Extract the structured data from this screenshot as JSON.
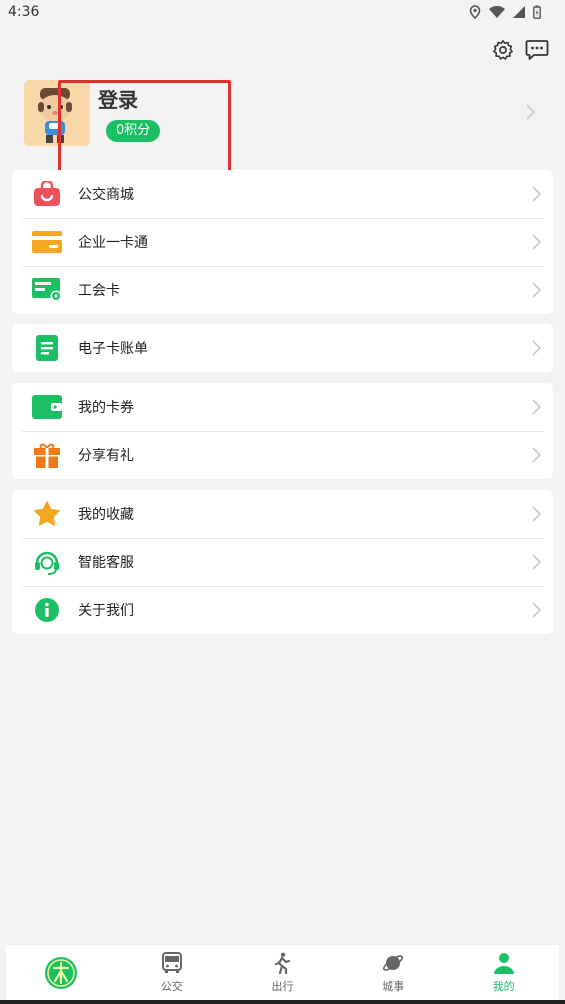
{
  "status_bar": {
    "time": "4:36",
    "icons": [
      "location-icon",
      "wifi-icon",
      "signal-icon",
      "battery-icon"
    ]
  },
  "header": {
    "actions": [
      "settings-icon",
      "message-icon"
    ]
  },
  "profile": {
    "name": "登录",
    "points": "0积分"
  },
  "menu_groups": [
    {
      "items": [
        {
          "label": "公交商城",
          "icon": "shopping-bag-icon",
          "color": "#f0505a"
        },
        {
          "label": "企业一卡通",
          "icon": "card-icon",
          "color": "#f5a623"
        },
        {
          "label": "工会卡",
          "icon": "union-card-icon",
          "color": "#1cbf63"
        }
      ]
    },
    {
      "items": [
        {
          "label": "电子卡账单",
          "icon": "bill-icon",
          "color": "#1cbf63"
        }
      ]
    },
    {
      "items": [
        {
          "label": "我的卡券",
          "icon": "wallet-icon",
          "color": "#1cbf63"
        },
        {
          "label": "分享有礼",
          "icon": "gift-icon",
          "color": "#f07a1a"
        }
      ]
    },
    {
      "items": [
        {
          "label": "我的收藏",
          "icon": "star-icon",
          "color": "#f5a623"
        },
        {
          "label": "智能客服",
          "icon": "headset-icon",
          "color": "#1cbf63"
        },
        {
          "label": "关于我们",
          "icon": "info-icon",
          "color": "#1cbf63"
        }
      ]
    }
  ],
  "tabs": [
    {
      "label": "",
      "icon": "app-logo-icon"
    },
    {
      "label": "公交",
      "icon": "bus-icon"
    },
    {
      "label": "出行",
      "icon": "walk-icon"
    },
    {
      "label": "城事",
      "icon": "planet-icon"
    },
    {
      "label": "我的",
      "icon": "person-icon",
      "active": true
    }
  ],
  "colors": {
    "accent": "#1cbf63",
    "highlight_box": "#e0312c"
  }
}
